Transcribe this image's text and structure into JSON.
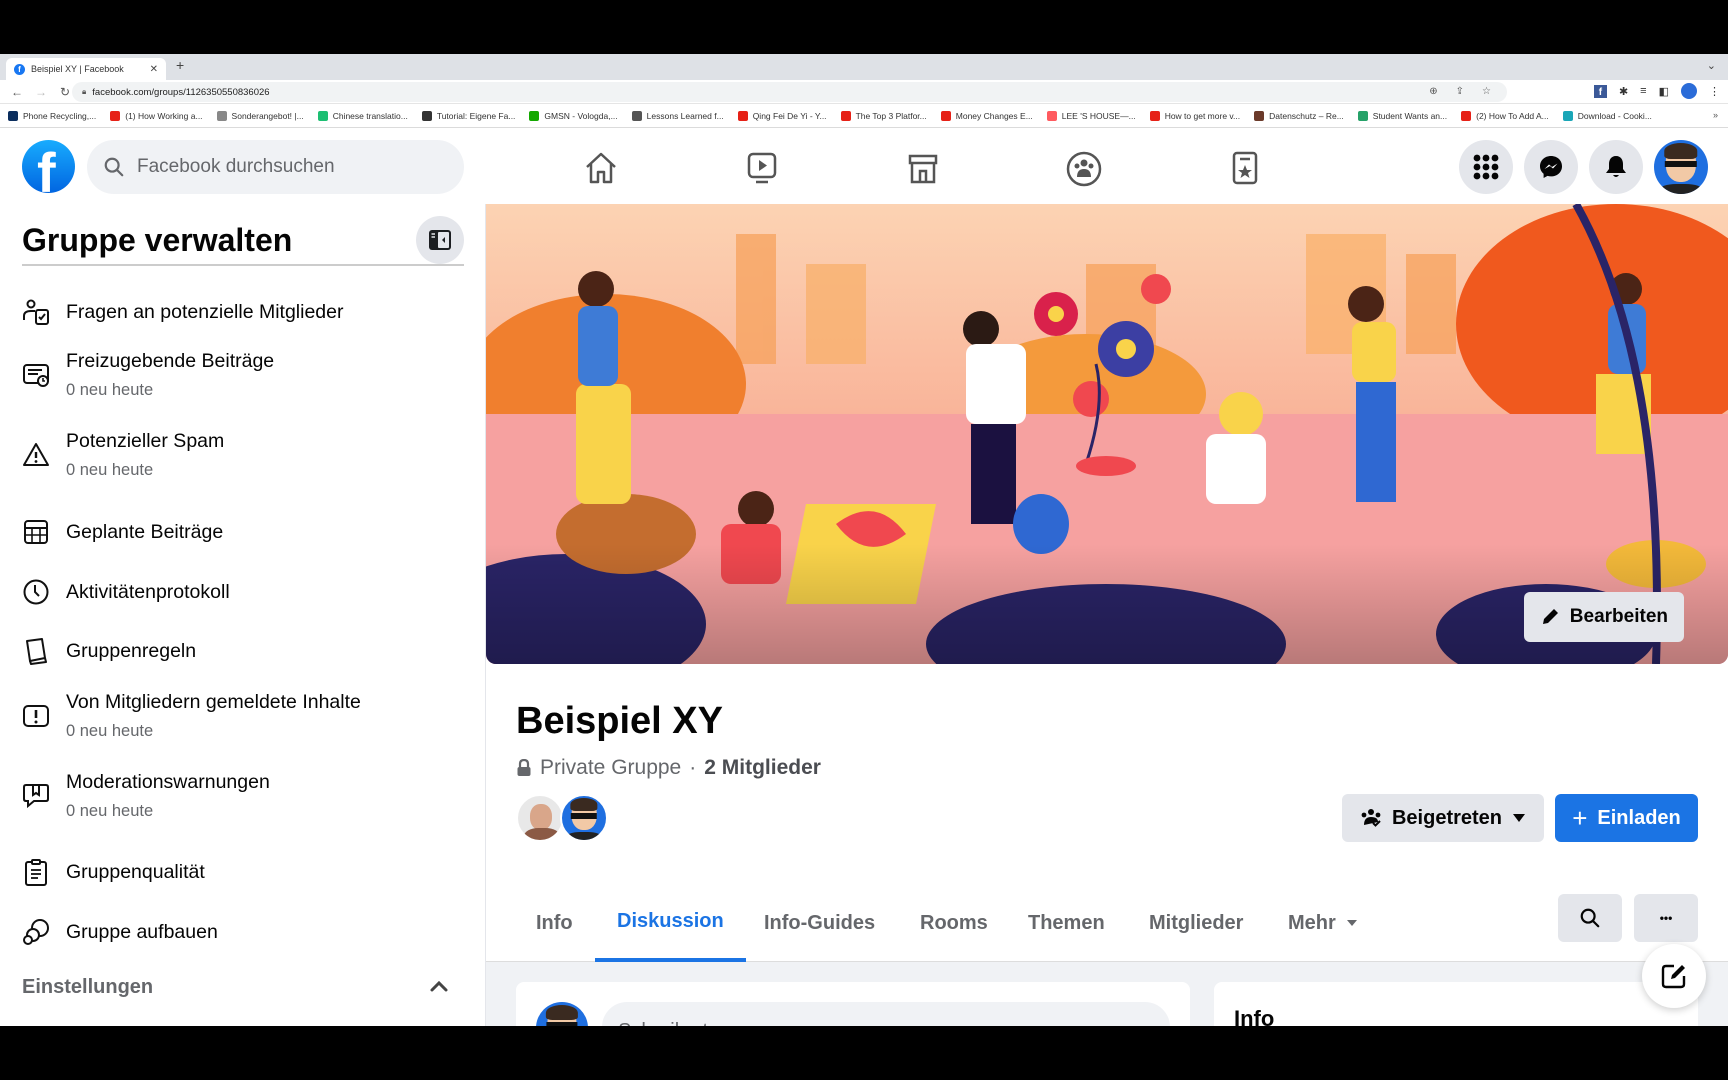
{
  "browser": {
    "tab_title": "Beispiel XY | Facebook",
    "url": "facebook.com/groups/1126350550836026",
    "bookmarks": [
      {
        "label": "Phone Recycling,...",
        "icon": "o2-icon",
        "color": "#0b2e5e"
      },
      {
        "label": "(1) How Working a...",
        "icon": "youtube-icon",
        "color": "#e62117"
      },
      {
        "label": "Sonderangebot! |...",
        "icon": "check-circle-icon",
        "color": "#888888"
      },
      {
        "label": "Chinese translatio...",
        "icon": "fiverr-icon",
        "color": "#1dbf73"
      },
      {
        "label": "Tutorial: Eigene Fa...",
        "icon": "hash-icon",
        "color": "#333333"
      },
      {
        "label": "GMSN - Vologda,...",
        "icon": "upwork-icon",
        "color": "#14a800"
      },
      {
        "label": "Lessons Learned f...",
        "icon": "er-icon",
        "color": "#555555"
      },
      {
        "label": "Qing Fei De Yi - Y...",
        "icon": "youtube-icon",
        "color": "#e62117"
      },
      {
        "label": "The Top 3 Platfor...",
        "icon": "youtube-icon",
        "color": "#e62117"
      },
      {
        "label": "Money Changes E...",
        "icon": "youtube-icon",
        "color": "#e62117"
      },
      {
        "label": "LEE 'S HOUSE—...",
        "icon": "airbnb-icon",
        "color": "#ff5a5f"
      },
      {
        "label": "How to get more v...",
        "icon": "youtube-icon",
        "color": "#e62117"
      },
      {
        "label": "Datenschutz – Re...",
        "icon": "image-icon",
        "color": "#6b3a2a"
      },
      {
        "label": "Student Wants an...",
        "icon": "t-icon",
        "color": "#26a269"
      },
      {
        "label": "(2) How To Add A...",
        "icon": "youtube-icon",
        "color": "#e62117"
      },
      {
        "label": "Download - Cooki...",
        "icon": "c-icon",
        "color": "#1aa6b7"
      }
    ]
  },
  "header": {
    "search_placeholder": "Facebook durchsuchen",
    "logo_letter": "f",
    "brand_color": "#1877f2"
  },
  "sidebar": {
    "title": "Gruppe verwalten",
    "items": [
      {
        "label": "Fragen an potenzielle Mitglieder",
        "sub": ""
      },
      {
        "label": "Freizugebende Beiträge",
        "sub": "0 neu heute"
      },
      {
        "label": "Potenzieller Spam",
        "sub": "0 neu heute"
      },
      {
        "label": "Geplante Beiträge",
        "sub": ""
      },
      {
        "label": "Aktivitätenprotokoll",
        "sub": ""
      },
      {
        "label": "Gruppenregeln",
        "sub": ""
      },
      {
        "label": "Von Mitgliedern gemeldete Inhalte",
        "sub": "0 neu heute"
      },
      {
        "label": "Moderationswarnungen",
        "sub": "0 neu heute"
      },
      {
        "label": "Gruppenqualität",
        "sub": ""
      },
      {
        "label": "Gruppe aufbauen",
        "sub": ""
      }
    ],
    "settings_label": "Einstellungen"
  },
  "group": {
    "edit_label": "Bearbeiten",
    "name": "Beispiel XY",
    "privacy": "Private Gruppe",
    "separator": "·",
    "members": "2 Mitglieder",
    "joined_label": "Beigetreten",
    "invite_label": "Einladen",
    "invite_plus": "+",
    "accent": "#1b74e4"
  },
  "tabs": [
    {
      "label": "Info",
      "active": false
    },
    {
      "label": "Diskussion",
      "active": true
    },
    {
      "label": "Info-Guides",
      "active": false
    },
    {
      "label": "Rooms",
      "active": false
    },
    {
      "label": "Themen",
      "active": false
    },
    {
      "label": "Mitglieder",
      "active": false
    },
    {
      "label": "Mehr",
      "active": false
    }
  ],
  "more_dots": "•••",
  "composer": {
    "placeholder": "Schreib etwas ..."
  },
  "info_card": {
    "title": "Info"
  }
}
